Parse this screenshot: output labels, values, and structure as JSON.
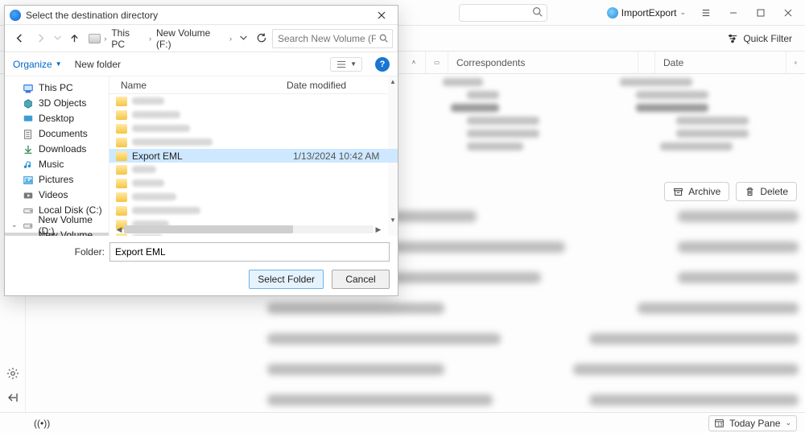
{
  "app": {
    "extension_label": "ImportExport",
    "quick_filter": "Quick Filter",
    "columns": {
      "correspondents": "Correspondents",
      "date": "Date"
    },
    "archive": "Archive",
    "delete": "Delete",
    "status_left": "((•))",
    "today_pane": "Today Pane"
  },
  "dialog": {
    "title": "Select the destination directory",
    "breadcrumb": {
      "root": "This PC",
      "volume": "New Volume (F:)"
    },
    "search_placeholder": "Search New Volume (F:)",
    "organize": "Organize",
    "new_folder": "New folder",
    "columns": {
      "name": "Name",
      "date": "Date modified"
    },
    "tree": [
      {
        "label": "This PC",
        "icon": "pc"
      },
      {
        "label": "3D Objects",
        "icon": "3d"
      },
      {
        "label": "Desktop",
        "icon": "desk"
      },
      {
        "label": "Documents",
        "icon": "doc"
      },
      {
        "label": "Downloads",
        "icon": "down"
      },
      {
        "label": "Music",
        "icon": "music"
      },
      {
        "label": "Pictures",
        "icon": "pic"
      },
      {
        "label": "Videos",
        "icon": "vid"
      },
      {
        "label": "Local Disk (C:)",
        "icon": "disk"
      },
      {
        "label": "New Volume (D:)",
        "icon": "disk",
        "exp": true
      },
      {
        "label": "New Volume (F:)",
        "icon": "disk",
        "exp": true,
        "selected": true
      }
    ],
    "files": {
      "selected_index": 5,
      "rows": [
        {
          "name": "",
          "date": "",
          "blur": true,
          "nw": 40,
          "dw": 90
        },
        {
          "name": "",
          "date": "",
          "blur": true,
          "nw": 60,
          "dw": 90
        },
        {
          "name": "",
          "date": "",
          "blur": true,
          "nw": 72,
          "dw": 90
        },
        {
          "name": "",
          "date": "",
          "blur": true,
          "nw": 100,
          "dw": 90
        },
        {
          "name": "Export EML",
          "date": "1/13/2024 10:42 AM",
          "blur": false
        },
        {
          "name": "",
          "date": "",
          "blur": true,
          "nw": 30,
          "dw": 90
        },
        {
          "name": "",
          "date": "",
          "blur": true,
          "nw": 40,
          "dw": 90
        },
        {
          "name": "",
          "date": "",
          "blur": true,
          "nw": 55,
          "dw": 90
        },
        {
          "name": "",
          "date": "",
          "blur": true,
          "nw": 85,
          "dw": 90
        },
        {
          "name": "",
          "date": "",
          "blur": true,
          "nw": 46,
          "dw": 90
        },
        {
          "name": "",
          "date": "",
          "blur": true,
          "nw": 38,
          "dw": 90
        }
      ]
    },
    "folder_label": "Folder:",
    "folder_value": "Export EML",
    "select_folder": "Select Folder",
    "cancel": "Cancel"
  }
}
